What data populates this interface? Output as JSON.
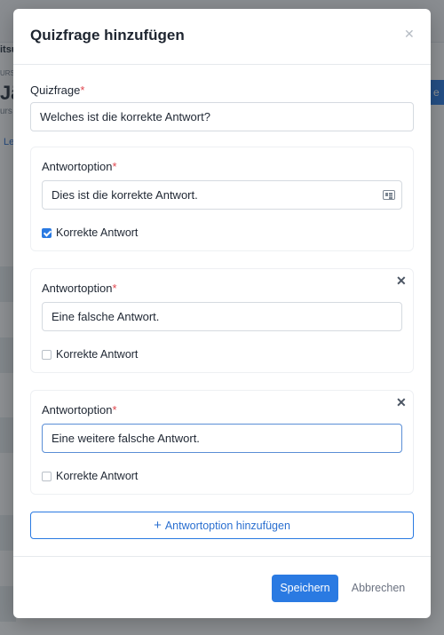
{
  "modal": {
    "title": "Quizfrage hinzufügen",
    "close_icon": "close-icon"
  },
  "question": {
    "label": "Quizfrage",
    "required_marker": "*",
    "value": "Welches ist die korrekte Antwort?"
  },
  "answers": [
    {
      "label": "Antwortoption",
      "required_marker": "*",
      "value": "Dies ist die korrekte Antwort.",
      "correct_label": "Korrekte Antwort",
      "correct": true,
      "removable": false
    },
    {
      "label": "Antwortoption",
      "required_marker": "*",
      "value": "Eine falsche Antwort.",
      "correct_label": "Korrekte Antwort",
      "correct": false,
      "removable": true
    },
    {
      "label": "Antwortoption",
      "required_marker": "*",
      "value": "Eine weitere falsche Antwort.",
      "correct_label": "Korrekte Antwort",
      "correct": false,
      "removable": true
    }
  ],
  "add_answer": {
    "icon": "+",
    "label": "Antwortoption hinzufügen"
  },
  "footer": {
    "save_label": "Speichern",
    "cancel_label": "Abbrechen"
  },
  "background": {
    "frag1": "itsu",
    "frag2": "URS",
    "frag3": "Jä",
    "frag4": "urs",
    "frag5": "Le",
    "btn_frag": "n e"
  },
  "colors": {
    "accent": "#2a7ae2",
    "required": "#e0454d"
  }
}
